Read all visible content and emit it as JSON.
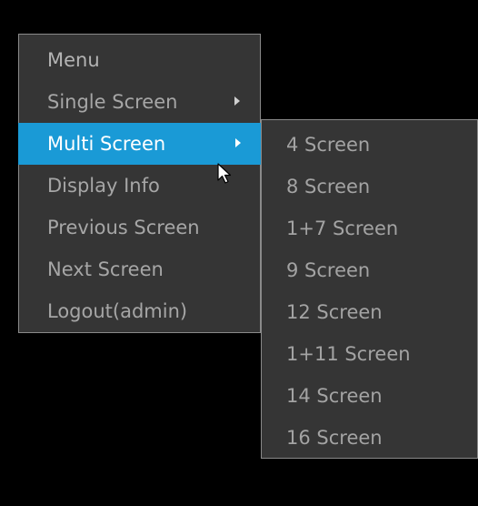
{
  "main_menu": {
    "items": [
      {
        "label": "Menu"
      },
      {
        "label": "Single Screen",
        "icon": "chevron-right-icon"
      },
      {
        "label": "Multi Screen",
        "icon": "chevron-right-icon",
        "state": "highlighted"
      },
      {
        "label": "Display Info"
      },
      {
        "label": "Previous Screen"
      },
      {
        "label": "Next Screen"
      },
      {
        "label": "Logout(admin)"
      }
    ]
  },
  "multi_screen_submenu": {
    "items": [
      {
        "label": "4 Screen"
      },
      {
        "label": "8 Screen"
      },
      {
        "label": "1+7 Screen"
      },
      {
        "label": "9 Screen"
      },
      {
        "label": "12 Screen"
      },
      {
        "label": "1+11 Screen"
      },
      {
        "label": "14 Screen"
      },
      {
        "label": "16 Screen"
      }
    ]
  },
  "colors": {
    "background": "#000000",
    "menu_bg": "#353535",
    "menu_border": "#8a8a8a",
    "highlight": "#1a9ad6",
    "text": "#a6a6a6",
    "highlight_text": "#ffffff"
  },
  "cursor": {
    "icon": "mouse-pointer-icon"
  }
}
